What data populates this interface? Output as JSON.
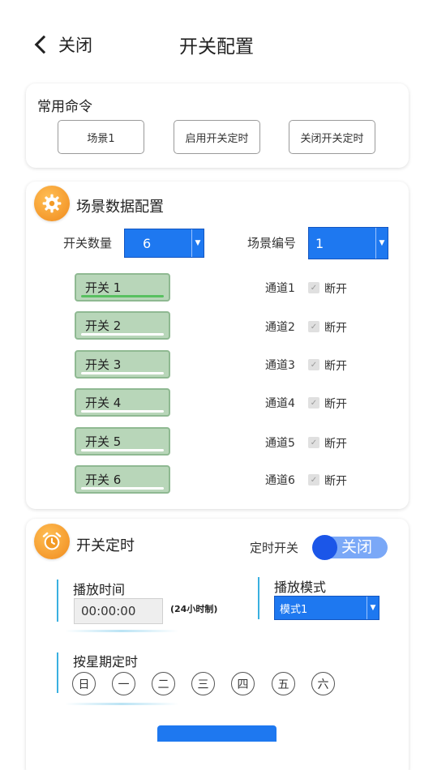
{
  "header": {
    "back_label": "关闭",
    "title": "开关配置"
  },
  "common": {
    "title": "常用命令",
    "buttons": [
      "场景1",
      "启用开关定时",
      "关闭开关定时"
    ]
  },
  "scene": {
    "title": "场景数据配置",
    "count_label": "开关数量",
    "count_value": "6",
    "id_label": "场景编号",
    "id_value": "1",
    "switches": [
      {
        "label": "开关 1",
        "channel": "通道1",
        "state": "断开"
      },
      {
        "label": "开关 2",
        "channel": "通道2",
        "state": "断开"
      },
      {
        "label": "开关 3",
        "channel": "通道3",
        "state": "断开"
      },
      {
        "label": "开关 4",
        "channel": "通道4",
        "state": "断开"
      },
      {
        "label": "开关 5",
        "channel": "通道5",
        "state": "断开"
      },
      {
        "label": "开关 6",
        "channel": "通道6",
        "state": "断开"
      }
    ]
  },
  "timer": {
    "title": "开关定时",
    "toggle_label": "定时开关",
    "toggle_state": "关闭",
    "play_time_label": "播放时间",
    "play_time_value": "00:00:00",
    "play_time_hint": "(24小时制)",
    "play_mode_label": "播放模式",
    "play_mode_value": "模式1",
    "week_label": "按星期定时",
    "days": [
      "日",
      "一",
      "二",
      "三",
      "四",
      "五",
      "六"
    ]
  },
  "colors": {
    "accent": "#1e78f0",
    "switch_bg": "#b8d6b9",
    "badge": "#f5a02a",
    "toggle_knob": "#1b56e8"
  }
}
